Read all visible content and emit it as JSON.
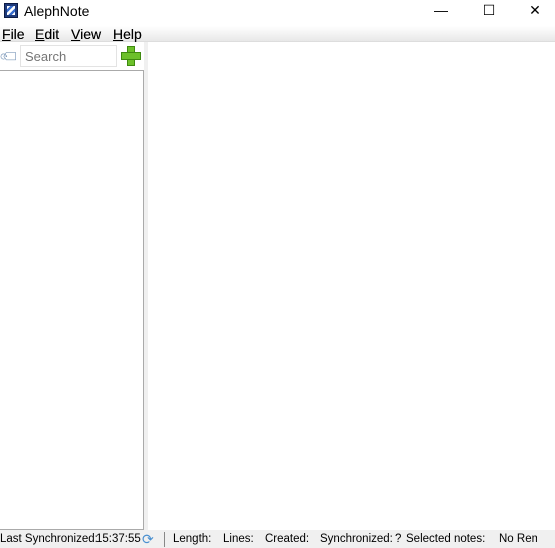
{
  "window": {
    "title": "AlephNote",
    "minimize": "—",
    "maximize": "☐",
    "close": "✕"
  },
  "menu": [
    {
      "label": "File",
      "key": "F",
      "rest": "ile"
    },
    {
      "label": "Edit",
      "key": "E",
      "rest": "dit"
    },
    {
      "label": "View",
      "key": "V",
      "rest": "iew"
    },
    {
      "label": "Help",
      "key": "H",
      "rest": "elp"
    }
  ],
  "search": {
    "placeholder": "Search",
    "value": ""
  },
  "status": {
    "last_sync_label": "Last Synchronized:",
    "last_sync_value": "15:37:55",
    "length_label": "Length:",
    "lines_label": "Lines:",
    "created_label": "Created:",
    "synchronized_label": "Synchronized:",
    "synchronized_value": "?",
    "selected_label": "Selected notes:",
    "remote_label": "No Rem"
  },
  "icons": {
    "app": "alephnote-icon",
    "tag": "tag-icon",
    "add": "plus-icon",
    "sync": "sync-icon"
  },
  "colors": {
    "accent": "#6cc02a"
  }
}
